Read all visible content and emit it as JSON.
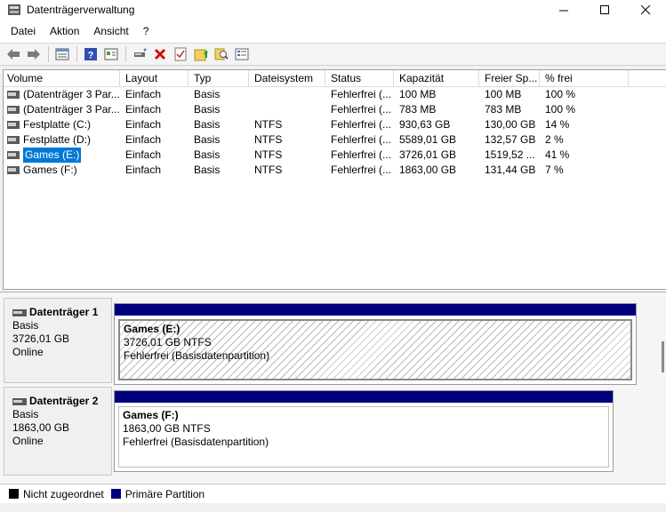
{
  "window": {
    "title": "Datenträgerverwaltung"
  },
  "menu": [
    "Datei",
    "Aktion",
    "Ansicht",
    "?"
  ],
  "toolbar": {
    "buttons": [
      "back-icon",
      "forward-icon",
      "list-view-icon",
      "help-icon",
      "properties-icon",
      "connect-drive-icon",
      "delete-icon",
      "checkmark-icon",
      "folder-up-icon",
      "search-icon",
      "settings-icon"
    ]
  },
  "volume_list": {
    "columns": [
      "Volume",
      "Layout",
      "Typ",
      "Dateisystem",
      "Status",
      "Kapazität",
      "Freier Sp...",
      "% frei"
    ],
    "rows": [
      {
        "volume": "(Datenträger 3 Par...",
        "layout": "Einfach",
        "type": "Basis",
        "fs": "",
        "status": "Fehlerfrei (...",
        "capacity": "100 MB",
        "free": "100 MB",
        "pct": "100 %"
      },
      {
        "volume": "(Datenträger 3 Par...",
        "layout": "Einfach",
        "type": "Basis",
        "fs": "",
        "status": "Fehlerfrei (...",
        "capacity": "783 MB",
        "free": "783 MB",
        "pct": "100 %"
      },
      {
        "volume": "Festplatte (C:)",
        "layout": "Einfach",
        "type": "Basis",
        "fs": "NTFS",
        "status": "Fehlerfrei (...",
        "capacity": "930,63 GB",
        "free": "130,00 GB",
        "pct": "14 %"
      },
      {
        "volume": "Festplatte (D:)",
        "layout": "Einfach",
        "type": "Basis",
        "fs": "NTFS",
        "status": "Fehlerfrei (...",
        "capacity": "5589,01 GB",
        "free": "132,57 GB",
        "pct": "2 %"
      },
      {
        "volume": "Games (E:)",
        "layout": "Einfach",
        "type": "Basis",
        "fs": "NTFS",
        "status": "Fehlerfrei (...",
        "capacity": "3726,01 GB",
        "free": "1519,52 ...",
        "pct": "41 %"
      },
      {
        "volume": "Games (F:)",
        "layout": "Einfach",
        "type": "Basis",
        "fs": "NTFS",
        "status": "Fehlerfrei (...",
        "capacity": "1863,00 GB",
        "free": "131,44 GB",
        "pct": "7 %"
      }
    ],
    "selected_index": 4
  },
  "disks": [
    {
      "name": "Datenträger 1",
      "type": "Basis",
      "size": "3726,01 GB",
      "state": "Online",
      "partition": {
        "name": "Games  (E:)",
        "size_fs": "3726,01 GB NTFS",
        "status": "Fehlerfrei (Basisdatenpartition)",
        "selected": true
      }
    },
    {
      "name": "Datenträger 2",
      "type": "Basis",
      "size": "1863,00 GB",
      "state": "Online",
      "partition": {
        "name": "Games  (F:)",
        "size_fs": "1863,00 GB NTFS",
        "status": "Fehlerfrei (Basisdatenpartition)",
        "selected": false
      }
    }
  ],
  "legend": [
    {
      "label": "Nicht zugeordnet",
      "color": "#000000"
    },
    {
      "label": "Primäre Partition",
      "color": "#00007f"
    }
  ]
}
